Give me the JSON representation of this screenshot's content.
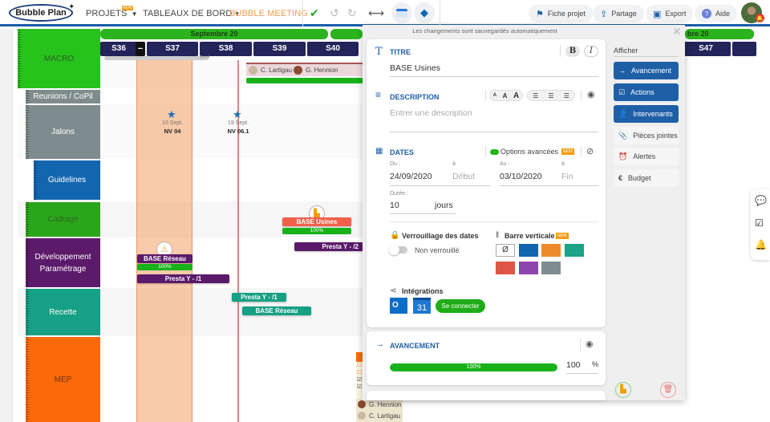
{
  "topbar": {
    "logo": "Bubble Plan",
    "nav": [
      {
        "label": "PROJETS",
        "badge": "NEW"
      },
      {
        "label": "TABLEAUX DE BORD"
      },
      {
        "label": "BUBBLE MEETING"
      }
    ],
    "actions": [
      {
        "label": "Fiche projet",
        "icon": "flag-icon"
      },
      {
        "label": "Partage",
        "icon": "share-icon"
      },
      {
        "label": "Export",
        "icon": "image-icon"
      },
      {
        "label": "Aide",
        "icon": "help-icon"
      }
    ],
    "colors": {
      "accent": "#1a5ea8",
      "meeting": "#f39c4a"
    }
  },
  "timeline": {
    "month": "Septembre 20",
    "month_right": "bre 20",
    "weeks": [
      "S36",
      "S37",
      "S38",
      "S39",
      "S40",
      "S47"
    ],
    "collapse_label": "−"
  },
  "rows": [
    {
      "label": "MACRO",
      "color": "#27c21b",
      "text_color": "#333"
    },
    {
      "label": "Reunions / CoPil",
      "color": "#7f8c8d"
    },
    {
      "label": "Jalons",
      "color": "#7f8c8d"
    },
    {
      "label": "Guidelines",
      "color": "#1266b0"
    },
    {
      "label": "Cadrage",
      "color": "#2aa61a",
      "text_color": "#2d6b22"
    },
    {
      "label": "Développement\nParamétrage",
      "color": "#5b1a6a"
    },
    {
      "label": "Recette",
      "color": "#16a085"
    },
    {
      "label": "MEP",
      "color": "#fa6a0a",
      "text_color": "#6b3410"
    }
  ],
  "milestones": [
    {
      "date": "10 Sept.",
      "name": "NV 04"
    },
    {
      "date": "19 Sept.",
      "name": "NV 06.1"
    }
  ],
  "macro_people": [
    "C. Lartigau",
    "G. Hennion"
  ],
  "tasks": [
    {
      "label": "BASE Usines",
      "progress": "100%",
      "color": "#f0604a"
    },
    {
      "label": "Presta Y - /2",
      "color": "#5b1a6a"
    },
    {
      "label": "BASE Réseau",
      "progress": "100%",
      "color": "#5b1a6a"
    },
    {
      "label": "Presta Y - /1",
      "color": "#5b1a6a"
    },
    {
      "label": "Presta Y - /1",
      "color": "#16a085"
    },
    {
      "label": "BASE Réseau",
      "color": "#16a085"
    }
  ],
  "mep_people": [
    "G. Hennion",
    "C. Lartigau"
  ],
  "panel": {
    "note": "Les changements sont sauvegardés automatiquement",
    "title_section": {
      "label": "TITRE",
      "value": "BASE Usines",
      "bold": "B",
      "italic": "I"
    },
    "description": {
      "label": "DESCRIPTION",
      "placeholder": "Entrer une description",
      "sizes": [
        "A",
        "A",
        "A"
      ]
    },
    "dates": {
      "label": "DATES",
      "advanced": "Options avancées",
      "badge": "NEW",
      "from_label": "Du :",
      "from_value": "24/09/2020",
      "a_label": "à",
      "start_ph": "Début",
      "to_label": "Au :",
      "to_value": "03/10/2020",
      "end_ph": "Fin",
      "duration_label": "Durée :",
      "duration_value": "10",
      "duration_unit": "jours"
    },
    "lock": {
      "label": "Verrouillage des dates",
      "state": "Non verrouillé"
    },
    "vertical_bar": {
      "label": "Barre verticale",
      "badge": "NEW",
      "none": "Ø",
      "colors": [
        "#1266b0",
        "#ee8a2a",
        "#1aa386",
        "#de5545",
        "#8e44ad",
        "#7f8c8d"
      ]
    },
    "integrations": {
      "label": "Intégrations",
      "calendar_day": "31",
      "connect": "Se connecter"
    },
    "progress": {
      "label": "AVANCEMENT",
      "bar_label": "100%",
      "value": "100",
      "unit": "%",
      "fraction": 1.0
    }
  },
  "sidebar": {
    "title": "Afficher",
    "items": [
      {
        "label": "Avancement",
        "active": true
      },
      {
        "label": "Actions",
        "active": true
      },
      {
        "label": "Intervenants",
        "active": true
      },
      {
        "label": "Pièces jointes",
        "active": false
      },
      {
        "label": "Alertes",
        "active": false
      },
      {
        "label": "Budget",
        "active": false
      }
    ]
  }
}
